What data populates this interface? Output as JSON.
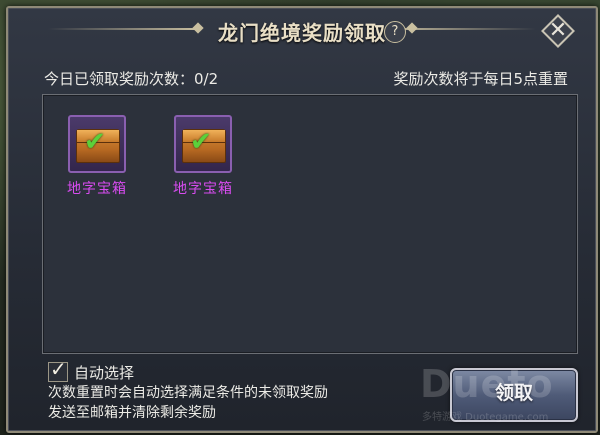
{
  "dialog": {
    "title": "龙门绝境奖励领取",
    "help_label": "?",
    "close_label": "✕"
  },
  "info": {
    "claimed_label": "今日已领取奖励次数：0/2",
    "reset_note": "奖励次数将于每日5点重置"
  },
  "rewards": [
    {
      "name": "地字宝箱",
      "claimed": true,
      "icon": "treasure-chest-icon"
    },
    {
      "name": "地字宝箱",
      "claimed": true,
      "icon": "treasure-chest-icon"
    }
  ],
  "auto_select": {
    "checked": true,
    "label": "自动选择",
    "note_line1": "次数重置时会自动选择满足条件的未领取奖励",
    "note_line2": "发送至邮箱并清除剩余奖励"
  },
  "claim_button": {
    "label": "领取"
  },
  "watermark": {
    "big": "Dueto",
    "small": "多特游戏 Duotegame.com"
  },
  "colors": {
    "reward_name": "#d84cf0",
    "check": "#5cd03a"
  }
}
